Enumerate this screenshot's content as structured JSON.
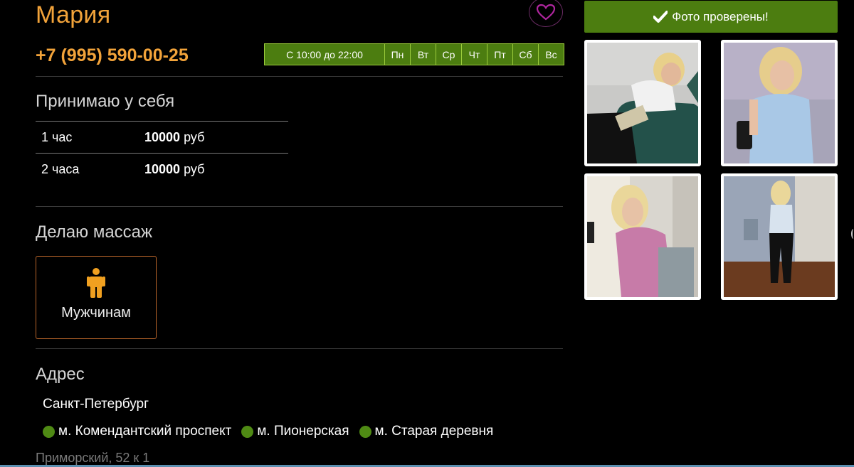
{
  "profile": {
    "name": "Мария",
    "phone": "+7 (995) 590-00-25"
  },
  "schedule": {
    "hours": "С 10:00 до 22:00",
    "days": [
      "Пн",
      "Вт",
      "Ср",
      "Чт",
      "Пт",
      "Сб",
      "Вс"
    ]
  },
  "incall": {
    "title": "Принимаю у себя",
    "rows": [
      {
        "duration": "1 час",
        "price": "10000",
        "currency": "руб"
      },
      {
        "duration": "2 часа",
        "price": "10000",
        "currency": "руб"
      }
    ]
  },
  "massage": {
    "title": "Делаю массаж",
    "for_label": "Мужчинам"
  },
  "address": {
    "title": "Адрес",
    "city": "Санкт-Петербург",
    "metro": [
      "м. Комендантский проспект",
      "м. Пионерская",
      "м. Старая деревня"
    ],
    "street": "Приморский, 52 к 1"
  },
  "photos": {
    "verified_label": "Фото проверены!",
    "count": 4
  },
  "colors": {
    "accent_orange": "#f2a33a",
    "accent_green": "#4c7d10",
    "metro_dot": "#4f8a14",
    "background": "#000000"
  },
  "icons": [
    "heart-icon",
    "check-icon",
    "man-icon"
  ]
}
